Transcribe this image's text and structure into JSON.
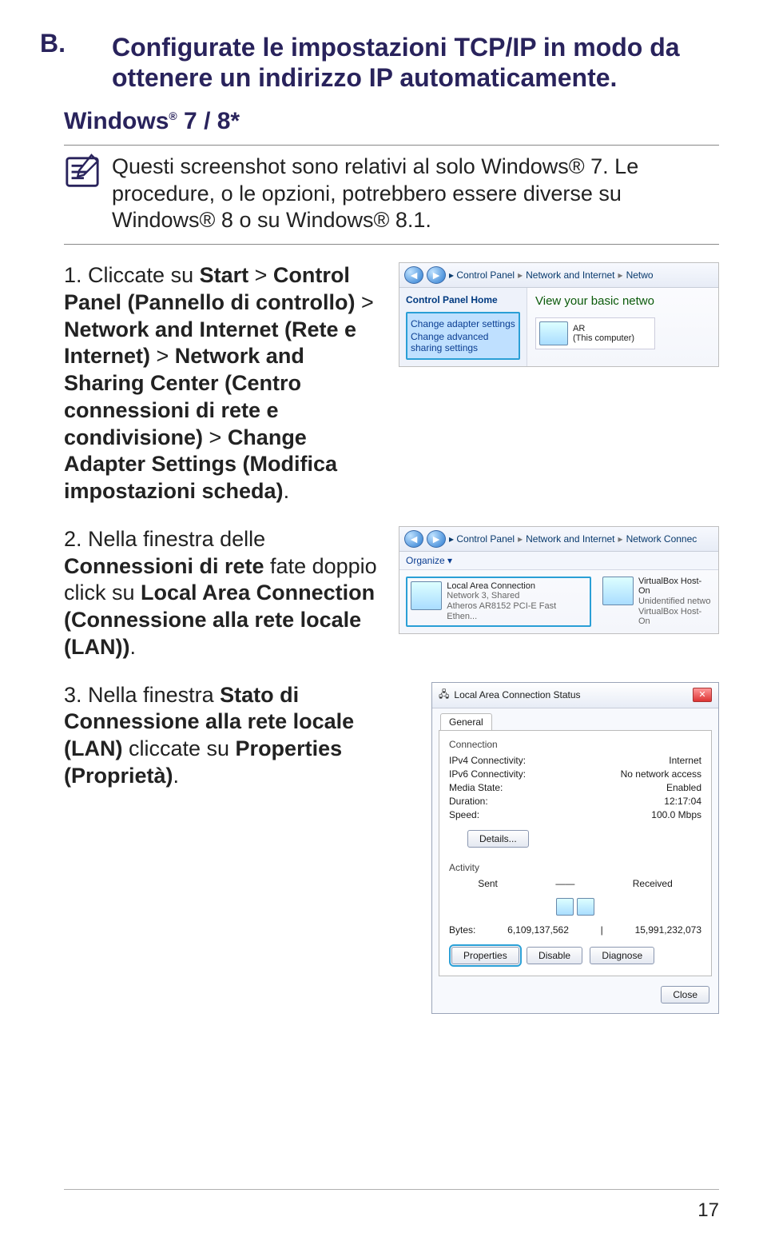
{
  "section": {
    "label": "B.",
    "heading": "Configurate le impostazioni TCP/IP in modo da ottenere un indirizzo IP automaticamente.",
    "subheading_prefix": "Windows",
    "subheading_suffix": " 7 / 8*",
    "trademark": "®"
  },
  "note": "Questi screenshot sono relativi al solo Windows® 7. Le procedure, o le opzioni, potrebbero essere diverse su Windows® 8 o su Windows® 8.1.",
  "steps": {
    "s1": {
      "num": "1.",
      "pre": "Cliccate su ",
      "path1": "Start",
      "gt1": " > ",
      "path2": "Control Panel (Pannello di controllo)",
      "gt2": " > ",
      "path3": "Network and Internet (Rete e Internet)",
      "gt3": " > ",
      "path4": "Network and Sharing Center (Centro connessioni di rete e condivisione)",
      "gt4": " > ",
      "path5": "Change Adapter Settings (Modifica impostazioni scheda)",
      "tail": "."
    },
    "s2": {
      "num": "2.",
      "t1": "Nella finestra delle ",
      "b1": "Connessioni di rete",
      "t2": " fate doppio click su ",
      "b2": "Local Area Connection (Connessione alla rete locale (LAN))",
      "t3": "."
    },
    "s3": {
      "num": "3.",
      "t1": "Nella finestra ",
      "b1": "Stato di Connessione alla rete locale (LAN)",
      "t2": " cliccate su ",
      "b2": "Properties (Proprietà)",
      "t3": "."
    }
  },
  "shot1": {
    "crumb1": "Control Panel",
    "crumb2": "Network and Internet",
    "crumb3": "Netwo",
    "side_title": "Control Panel Home",
    "side_link1": "Change adapter settings",
    "side_link2": "Change advanced sharing settings",
    "main_link": "View your basic netwo",
    "comp_name": "AR",
    "comp_sub": "(This computer)"
  },
  "shot2": {
    "crumb1": "Control Panel",
    "crumb2": "Network and Internet",
    "crumb3": "Network Connec",
    "toolbar": "Organize ▾",
    "lac_title": "Local Area Connection",
    "lac_sub1": "Network 3, Shared",
    "lac_sub2": "Atheros AR8152 PCI-E Fast Ethen...",
    "vb1_title": "VirtualBox Host-On",
    "vb1_sub": "Unidentified netwo",
    "vb2_title": "VirtualBox Host-On"
  },
  "shot3": {
    "title": "Local Area Connection Status",
    "tab": "General",
    "grp_conn": "Connection",
    "ipv4_k": "IPv4 Connectivity:",
    "ipv4_v": "Internet",
    "ipv6_k": "IPv6 Connectivity:",
    "ipv6_v": "No network access",
    "media_k": "Media State:",
    "media_v": "Enabled",
    "dur_k": "Duration:",
    "dur_v": "12:17:04",
    "speed_k": "Speed:",
    "speed_v": "100.0 Mbps",
    "details": "Details...",
    "grp_act": "Activity",
    "sent": "Sent",
    "recv": "Received",
    "bytes_k": "Bytes:",
    "bytes_sent": "6,109,137,562",
    "bytes_recv": "15,991,232,073",
    "btn_props": "Properties",
    "btn_disable": "Disable",
    "btn_diag": "Diagnose",
    "btn_close": "Close"
  },
  "page_number": "17"
}
